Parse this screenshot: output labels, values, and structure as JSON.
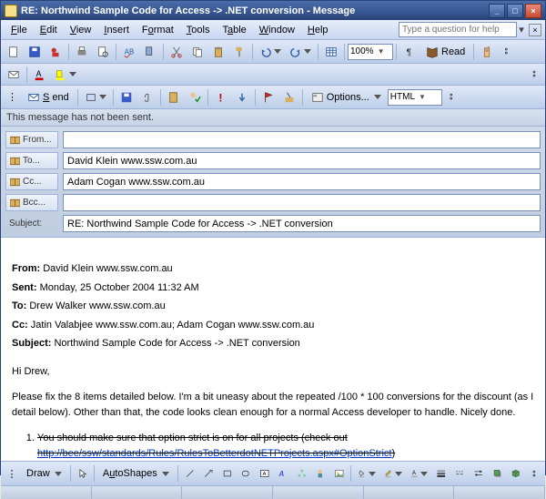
{
  "window": {
    "title": "RE: Northwind Sample Code for Access -> .NET conversion  - Message"
  },
  "menu": {
    "items": [
      "File",
      "Edit",
      "View",
      "Insert",
      "Format",
      "Tools",
      "Table",
      "Window",
      "Help"
    ],
    "help_placeholder": "Type a question for help"
  },
  "toolbar": {
    "zoom": "100%",
    "read_label": "Read"
  },
  "send": {
    "label": "Send",
    "options_label": "Options...",
    "format_select": "HTML"
  },
  "notice": "This message has not been sent.",
  "headers": {
    "from_label": "From...",
    "from_value": "",
    "to_label": "To...",
    "to_value": "David Klein www.ssw.com.au",
    "cc_label": "Cc...",
    "cc_value": "Adam Cogan www.ssw.com.au",
    "bcc_label": "Bcc...",
    "bcc_value": "",
    "subject_label": "Subject:",
    "subject_value": "RE: Northwind Sample Code for Access -> .NET conversion"
  },
  "body": {
    "from_label": "From:",
    "from_value": "David Klein www.ssw.com.au",
    "sent_label": "Sent:",
    "sent_value": "Monday, 25 October 2004 11:32 AM",
    "to_label": "To:",
    "to_value": "Drew Walker www.ssw.com.au",
    "cc_label": "Cc:",
    "cc_value": "Jatin Valabjee www.ssw.com.au; Adam Cogan www.ssw.com.au",
    "subject_label": "Subject:",
    "subject_value": "Northwind Sample Code for Access -> .NET conversion",
    "greeting": "Hi Drew,",
    "paragraph": "Please fix the 8 items detailed below. I'm a bit uneasy about the repeated /100 * 100 conversions for the discount (as I detail below). Other than that, the code looks clean enough for a normal Access developer to handle. Nicely done.",
    "item1_text": "You should make sure that option strict is on for all projects (check out ",
    "item1_link": "http://bee/ssw/standards/Rules/RulesToBetterdotNETProjects.aspx#OptionStrict",
    "item1_tail": ")"
  },
  "bottom": {
    "draw_label": "Draw",
    "autoshapes_label": "AutoShapes"
  },
  "colors": {
    "titlebar_bg": "#3a5a96",
    "toolbar_bg": "#cfdaea",
    "accent": "#6a8acc"
  }
}
